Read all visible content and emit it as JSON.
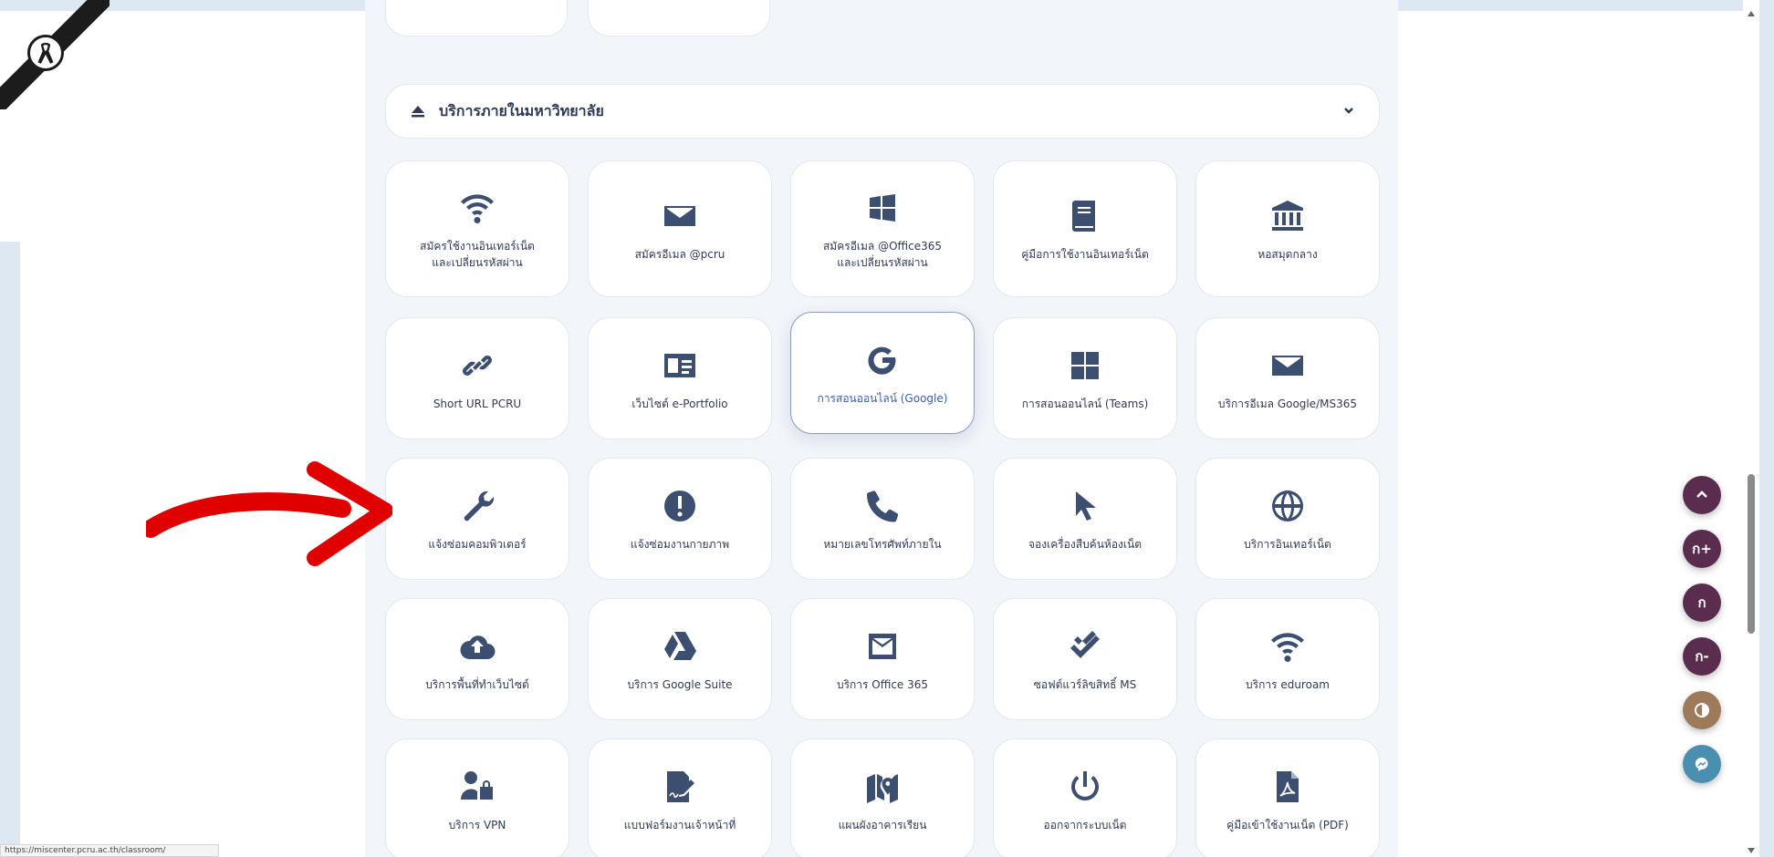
{
  "section": {
    "title": "บริการภายในมหาวิทยาลัย"
  },
  "services": [
    {
      "label": "สมัครใช้งานอินเทอร์เน็ต\nและเปลี่ยนรหัสผ่าน",
      "icon": "wifi-icon"
    },
    {
      "label": "สมัครอีเมล @pcru",
      "icon": "envelope-icon"
    },
    {
      "label": "สมัครอีเมล @Office365\nและเปลี่ยนรหัสผ่าน",
      "icon": "windows-icon"
    },
    {
      "label": "คู่มือการใช้งานอินเทอร์เน็ต",
      "icon": "book-icon"
    },
    {
      "label": "หอสมุดกลาง",
      "icon": "library-icon"
    },
    {
      "label": "Short URL PCRU",
      "icon": "link-icon"
    },
    {
      "label": "เว็บไซต์ e-Portfolio",
      "icon": "id-card-icon"
    },
    {
      "label": "การสอนออนไลน์ (Google)",
      "icon": "google-icon"
    },
    {
      "label": "การสอนออนไลน์ (Teams)",
      "icon": "windows-grid-icon"
    },
    {
      "label": "บริการอีเมล Google/MS365",
      "icon": "envelope-icon"
    },
    {
      "label": "แจ้งซ่อมคอมพิวเตอร์",
      "icon": "wrench-icon"
    },
    {
      "label": "แจ้งซ่อมงานกายภาพ",
      "icon": "exclamation-icon"
    },
    {
      "label": "หมายเลขโทรศัพท์ภายใน",
      "icon": "phone-icon"
    },
    {
      "label": "จองเครื่องสืบค้นห้องเน็ต",
      "icon": "pointer-icon"
    },
    {
      "label": "บริการอินเทอร์เน็ต",
      "icon": "globe-icon"
    },
    {
      "label": "บริการพื้นที่ทำเว็บไซต์",
      "icon": "cloud-upload-icon"
    },
    {
      "label": "บริการ Google Suite",
      "icon": "google-drive-icon"
    },
    {
      "label": "บริการ Office 365",
      "icon": "envelope-square-icon"
    },
    {
      "label": "ซอฟต์แวร์ลิขสิทธิ์ MS",
      "icon": "double-check-icon"
    },
    {
      "label": "บริการ eduroam",
      "icon": "wifi-icon"
    },
    {
      "label": "บริการ VPN",
      "icon": "user-lock-icon"
    },
    {
      "label": "แบบฟอร์มงานเจ้าหน้าที่",
      "icon": "signature-icon"
    },
    {
      "label": "แผนผังอาคารเรียน",
      "icon": "map-pin-icon"
    },
    {
      "label": "ออกจากระบบเน็ต",
      "icon": "power-icon"
    },
    {
      "label": "คู่มือเข้าใช้งานเน็ต (PDF)",
      "icon": "pdf-icon"
    }
  ],
  "active_index": 7,
  "fabs": [
    {
      "icon": "chevron-up-icon",
      "text": "",
      "color": "#5a2d4f"
    },
    {
      "icon": "font-increase-icon",
      "text": "ก+",
      "color": "#5a2d4f"
    },
    {
      "icon": "font-reset-icon",
      "text": "ก",
      "color": "#5a2d4f"
    },
    {
      "icon": "font-decrease-icon",
      "text": "ก-",
      "color": "#5a2d4f"
    },
    {
      "icon": "contrast-icon",
      "text": "",
      "color": "#9c7a5a"
    },
    {
      "icon": "messenger-icon",
      "text": "",
      "color": "#4a8fb0"
    }
  ],
  "status_url": "https://miscenter.pcru.ac.th/classroom/",
  "colors": {
    "icon": "#3d4f70",
    "arrow": "#e00000",
    "panel_bg": "#f2f5f9",
    "active_label": "#3a5fb0"
  }
}
